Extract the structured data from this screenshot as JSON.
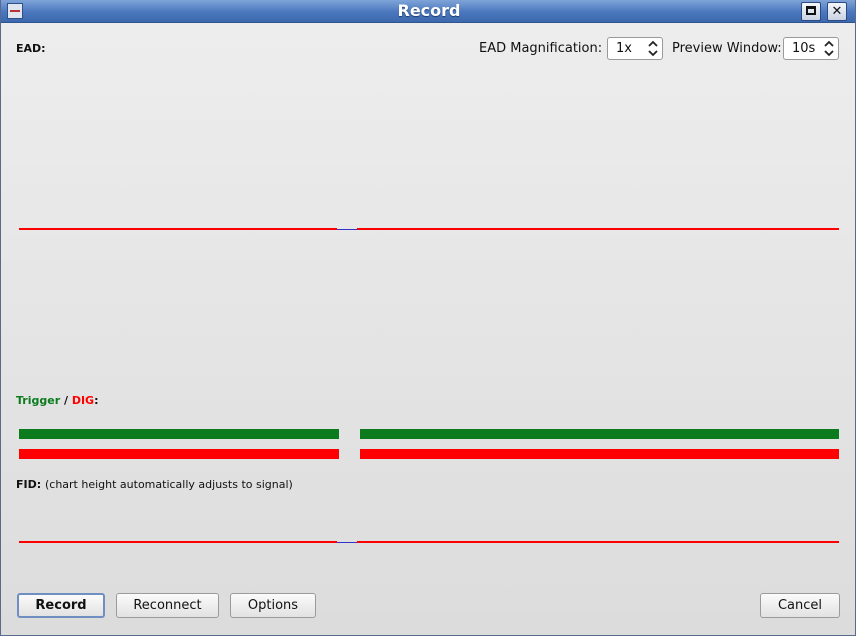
{
  "window": {
    "title": "Record"
  },
  "ead": {
    "label": "EAD:",
    "magnification_label": "EAD Magnification:",
    "magnification_value": "1x",
    "preview_label": "Preview Window:",
    "preview_value": "10s"
  },
  "trigger": {
    "label_trigger": "Trigger",
    "separator": " / ",
    "label_dig": "DIG",
    "colon": ":"
  },
  "fid": {
    "label": "FID:",
    "note": "(chart height automatically adjusts to signal)"
  },
  "buttons": {
    "record": "Record",
    "reconnect": "Reconnect",
    "options": "Options",
    "cancel": "Cancel"
  },
  "colors": {
    "trace": "#ff0000",
    "trigger": "#0b7b1e",
    "dig": "#ff0000",
    "titlebar": "#4a77bd"
  }
}
